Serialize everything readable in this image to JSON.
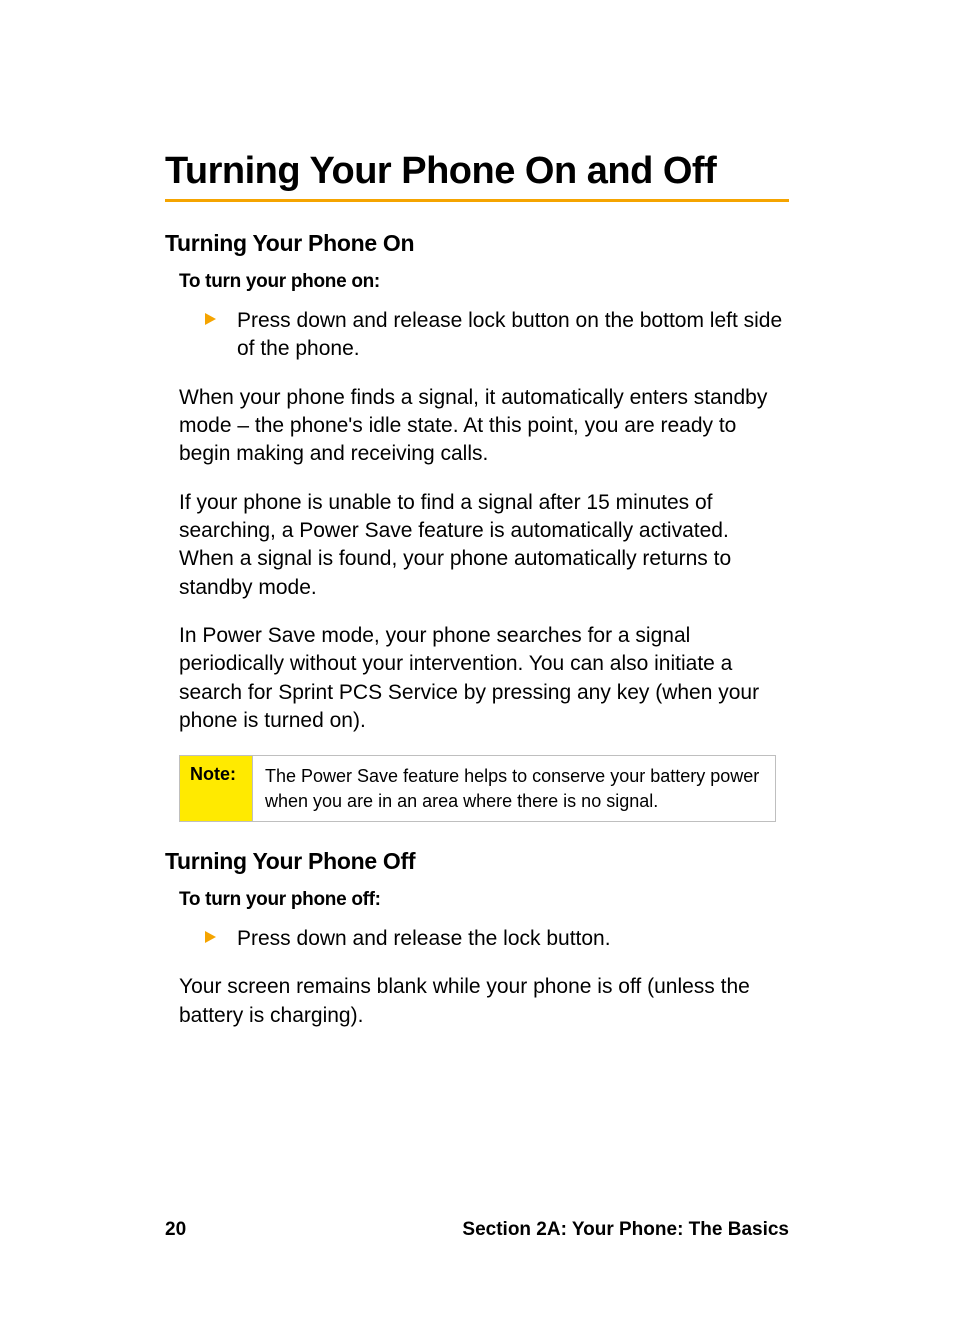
{
  "heading": "Turning Your Phone On and Off",
  "sections": {
    "on": {
      "title": "Turning Your Phone On",
      "instruct": "To turn your phone on:",
      "bullet": "Press down and release lock button on the bottom left side of the phone.",
      "para1": "When your phone finds a signal, it automatically enters standby mode – the phone's idle state. At this point, you are ready to begin making and receiving calls.",
      "para2": "If your phone is unable to find a signal after 15 minutes of searching, a Power Save feature is automatically activated. When a signal is found, your phone automatically returns to standby mode.",
      "para3": "In Power Save mode, your phone searches for a signal periodically without your intervention. You can also initiate a search for Sprint PCS Service by pressing any key (when your phone is turned on)."
    },
    "note": {
      "label": "Note:",
      "text": "The Power Save feature helps to conserve your battery power when you are in an area where there is no signal."
    },
    "off": {
      "title": "Turning Your Phone Off",
      "instruct": "To turn your phone off:",
      "bullet": "Press down and release the lock button.",
      "para1": "Your screen remains blank while your phone is off (unless the battery is charging)."
    }
  },
  "footer": {
    "page_number": "20",
    "section_label": "Section 2A: Your Phone: The Basics"
  },
  "colors": {
    "accent": "#f5a400",
    "note_bg": "#ffea00",
    "border": "#bfbfbf"
  }
}
